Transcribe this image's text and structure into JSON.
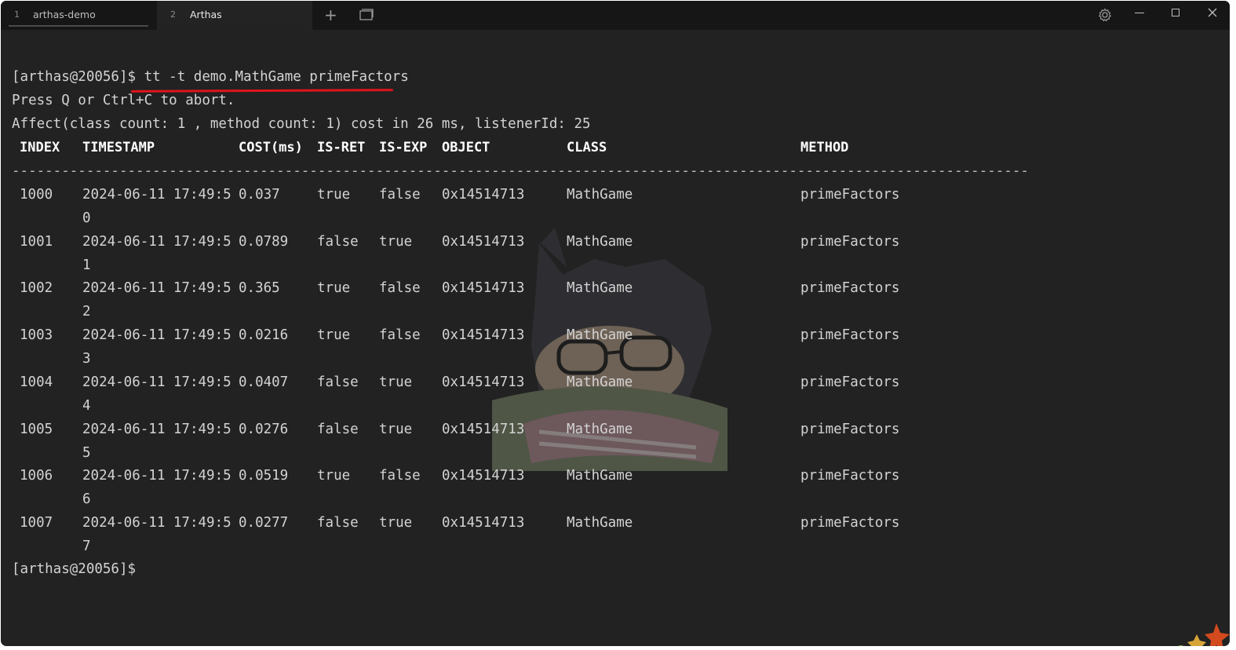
{
  "tabs": [
    {
      "number": "1",
      "title": "arthas-demo"
    },
    {
      "number": "2",
      "title": "Arthas"
    }
  ],
  "terminal": {
    "command_prompt": "[arthas@20056]$ ",
    "command": "tt -t demo.MathGame primeFactors",
    "abort_hint": "Press Q or Ctrl+C to abort.",
    "affect_line": "Affect(class count: 1 , method count: 1) cost in 26 ms, listenerId: 25",
    "headers": {
      "index": "INDEX",
      "timestamp": "TIMESTAMP",
      "cost": "COST(ms)",
      "is_ret": "IS-RET",
      "is_exp": "IS-EXP",
      "object": "OBJECT",
      "class": "CLASS",
      "method": "METHOD"
    },
    "separator": "-------------------------------------------------------------------------------------------------------------------------------------",
    "rows": [
      {
        "index": "1000",
        "ts": "2024-06-11 17:49:5",
        "ts_wrap": "0",
        "cost": "0.037",
        "is_ret": "true",
        "is_exp": "false",
        "object": "0x14514713",
        "cls": "MathGame",
        "method": "primeFactors"
      },
      {
        "index": "1001",
        "ts": "2024-06-11 17:49:5",
        "ts_wrap": "1",
        "cost": "0.0789",
        "is_ret": "false",
        "is_exp": "true",
        "object": "0x14514713",
        "cls": "MathGame",
        "method": "primeFactors"
      },
      {
        "index": "1002",
        "ts": "2024-06-11 17:49:5",
        "ts_wrap": "2",
        "cost": "0.365",
        "is_ret": "true",
        "is_exp": "false",
        "object": "0x14514713",
        "cls": "MathGame",
        "method": "primeFactors"
      },
      {
        "index": "1003",
        "ts": "2024-06-11 17:49:5",
        "ts_wrap": "3",
        "cost": "0.0216",
        "is_ret": "true",
        "is_exp": "false",
        "object": "0x14514713",
        "cls": "MathGame",
        "method": "primeFactors"
      },
      {
        "index": "1004",
        "ts": "2024-06-11 17:49:5",
        "ts_wrap": "4",
        "cost": "0.0407",
        "is_ret": "false",
        "is_exp": "true",
        "object": "0x14514713",
        "cls": "MathGame",
        "method": "primeFactors"
      },
      {
        "index": "1005",
        "ts": "2024-06-11 17:49:5",
        "ts_wrap": "5",
        "cost": "0.0276",
        "is_ret": "false",
        "is_exp": "true",
        "object": "0x14514713",
        "cls": "MathGame",
        "method": "primeFactors"
      },
      {
        "index": "1006",
        "ts": "2024-06-11 17:49:5",
        "ts_wrap": "6",
        "cost": "0.0519",
        "is_ret": "true",
        "is_exp": "false",
        "object": "0x14514713",
        "cls": "MathGame",
        "method": "primeFactors"
      },
      {
        "index": "1007",
        "ts": "2024-06-11 17:49:5",
        "ts_wrap": "7",
        "cost": "0.0277",
        "is_ret": "false",
        "is_exp": "true",
        "object": "0x14514713",
        "cls": "MathGame",
        "method": "primeFactors"
      }
    ],
    "final_prompt": "[arthas@20056]$"
  },
  "icons": {
    "new_tab": "plus-icon",
    "tab_overview": "tab-overview-icon",
    "settings": "gear-icon",
    "minimize": "minimize-icon",
    "maximize": "maximize-icon",
    "close": "close-icon"
  },
  "colors": {
    "terminal_bg": "#222222",
    "tabbar_bg": "#161616",
    "text": "#d3d3d3",
    "annotation": "#e0141a"
  }
}
